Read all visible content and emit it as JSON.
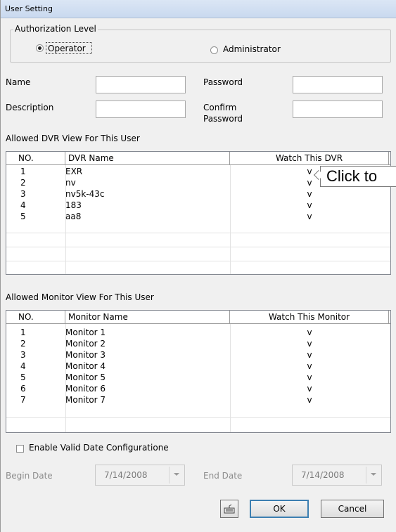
{
  "window": {
    "title": "User Setting"
  },
  "authorization": {
    "legend": "Authorization Level",
    "operator_label": "Operator",
    "administrator_label": "Administrator",
    "selected": "Operator"
  },
  "fields": {
    "name_label": "Name",
    "name_value": "",
    "description_label": "Description",
    "description_value": "",
    "password_label": "Password",
    "password_value": "",
    "confirm_label_line1": "Confirm",
    "confirm_label_line2": "Password",
    "confirm_value": ""
  },
  "dvr_section": {
    "title": "Allowed DVR View For This User",
    "columns": [
      "NO.",
      "DVR Name",
      "Watch This DVR"
    ],
    "rows": [
      {
        "no": "1",
        "name": "EXR",
        "watch": "v"
      },
      {
        "no": "2",
        "name": "nv",
        "watch": "v"
      },
      {
        "no": "3",
        "name": "nv5k-43c",
        "watch": "v"
      },
      {
        "no": "4",
        "name": "183",
        "watch": "v"
      },
      {
        "no": "5",
        "name": "aa8",
        "watch": "v"
      }
    ],
    "tooltip": "Click to"
  },
  "monitor_section": {
    "title": "Allowed Monitor View For This User",
    "columns": [
      "NO.",
      "Monitor Name",
      "Watch This Monitor"
    ],
    "rows": [
      {
        "no": "1",
        "name": "Monitor 1",
        "watch": "v"
      },
      {
        "no": "2",
        "name": "Monitor 2",
        "watch": "v"
      },
      {
        "no": "3",
        "name": "Monitor 3",
        "watch": "v"
      },
      {
        "no": "4",
        "name": "Monitor 4",
        "watch": "v"
      },
      {
        "no": "5",
        "name": "Monitor 5",
        "watch": "v"
      },
      {
        "no": "6",
        "name": "Monitor 6",
        "watch": "v"
      },
      {
        "no": "7",
        "name": "Monitor 7",
        "watch": "v"
      }
    ]
  },
  "date_config": {
    "enable_label": "Enable Valid Date Configuratione",
    "enabled": false,
    "begin_label": "Begin Date",
    "begin_value": "7/14/2008",
    "end_label": "End Date",
    "end_value": "7/14/2008"
  },
  "buttons": {
    "keyboard_icon": "keyboard-icon",
    "ok_label": "OK",
    "cancel_label": "Cancel"
  }
}
